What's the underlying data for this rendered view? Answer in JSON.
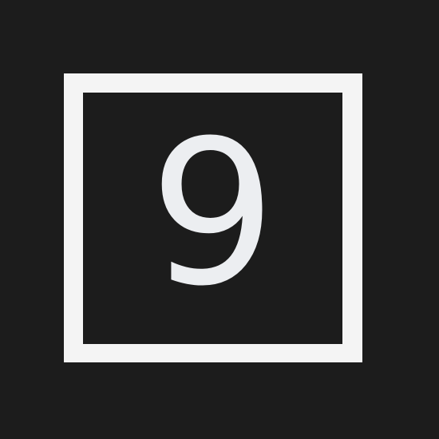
{
  "tile": {
    "digit": "9"
  },
  "colors": {
    "background": "#1c1c1c",
    "border": "#f4f4f4",
    "digit": "#eceef1"
  }
}
